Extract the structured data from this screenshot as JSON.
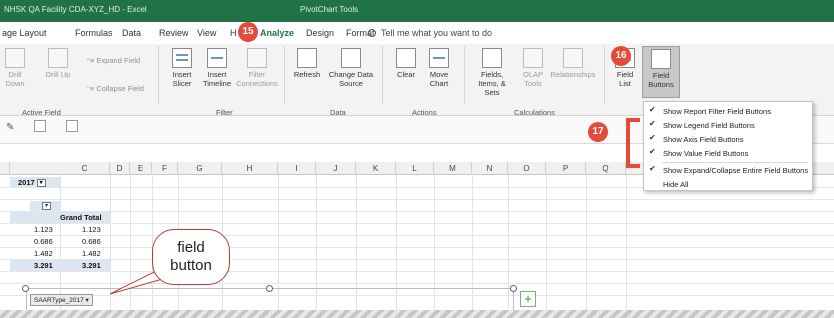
{
  "titlebar": {
    "left_text": "NHSK QA Facility CDA-XYZ_HD - Excel",
    "right_text": "PivotChart Tools"
  },
  "tabs": [
    {
      "label": "age Layout"
    },
    {
      "label": "Formulas"
    },
    {
      "label": "Data"
    },
    {
      "label": "Review"
    },
    {
      "label": "View"
    },
    {
      "label": "H"
    },
    {
      "label": "Analyze"
    },
    {
      "label": "Design"
    },
    {
      "label": "Format"
    }
  ],
  "tell_me": "Tell me what you want to do",
  "ribbon": {
    "active_field": {
      "drill_down": "Drill Down",
      "drill_up": "Drill Up",
      "expand_field": "Expand Field",
      "collapse_field": "Collapse Field",
      "group_label": "Active Field"
    },
    "filter": {
      "insert_slicer": "Insert Slicer",
      "insert_timeline": "Insert Timeline",
      "filter_connections": "Filter Connections",
      "group_label": "Filter"
    },
    "data": {
      "refresh": "Refresh",
      "change_data_source": "Change Data Source",
      "group_label": "Data"
    },
    "actions": {
      "clear": "Clear",
      "move_chart": "Move Chart",
      "group_label": "Actions"
    },
    "calculations": {
      "fields_items_sets": "Fields, Items, & Sets",
      "olap_tools": "OLAP Tools",
      "relationships": "Relationships",
      "group_label": "Calculations"
    },
    "show": {
      "field_list": "Field List",
      "field_buttons": "Field Buttons"
    }
  },
  "badges": {
    "b15": "15",
    "b16": "16",
    "b17": "17"
  },
  "field_buttons_menu": [
    {
      "label": "Show Report Filter Field Buttons",
      "checked": true
    },
    {
      "label": "Show Legend Field Buttons",
      "checked": true
    },
    {
      "label": "Show Axis Field Buttons",
      "checked": true
    },
    {
      "label": "Show Value Field Buttons",
      "checked": true
    },
    {
      "label": "Show Expand/Collapse Entire Field Buttons",
      "checked": true
    },
    {
      "label": "Hide All",
      "checked": false
    }
  ],
  "columns": [
    "C",
    "D",
    "E",
    "F",
    "G",
    "H",
    "I",
    "J",
    "K",
    "L",
    "M",
    "N",
    "O",
    "P",
    "Q"
  ],
  "pivot": {
    "filter_value": "2017",
    "grand_total_header": "Grand Total",
    "rows": [
      {
        "b": "1.123",
        "c": "1.123"
      },
      {
        "b": "0.686",
        "c": "0.686"
      },
      {
        "b": "1.482",
        "c": "1.482"
      },
      {
        "b": "3.291",
        "c": "3.291"
      }
    ]
  },
  "chart_field_button": "SAARType_2017",
  "callout": {
    "line1": "field",
    "line2": "button"
  },
  "colors": {
    "accent_green": "#217346",
    "callout_red": "#e34b3a"
  }
}
